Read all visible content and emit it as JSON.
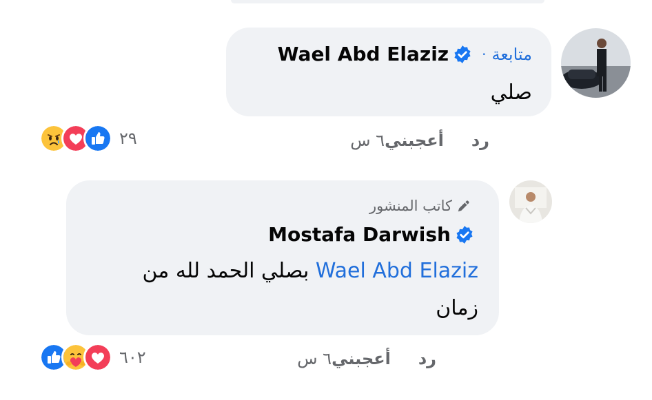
{
  "comments": [
    {
      "author": "Wael Abd Elaziz",
      "follow_label": "متابعة",
      "separator": "·",
      "text": "صلي",
      "time": "٦ س",
      "like_label": "أعجبني",
      "reply_label": "رد",
      "reaction_count": "٢٩",
      "reactions": [
        "sad-icon",
        "love-icon",
        "like-icon"
      ]
    },
    {
      "author": "Mostafa Darwish",
      "badge_label": "كاتب المنشور",
      "mention": "Wael Abd Elaziz",
      "text_line1_rest": "بصلي الحمد لله من",
      "text_line2": "زمان",
      "time": "٦ س",
      "like_label": "أعجبني",
      "reply_label": "رد",
      "reaction_count": "٦٠٢",
      "reactions": [
        "like-icon",
        "care-icon",
        "love-icon"
      ]
    }
  ],
  "colors": {
    "bubble": "#f0f2f5",
    "link": "#216fdb",
    "secondary_text": "#65676b",
    "like_blue": "#1877f2",
    "love_red": "#f33e58",
    "emoji_yellow": "#fcc33b"
  }
}
